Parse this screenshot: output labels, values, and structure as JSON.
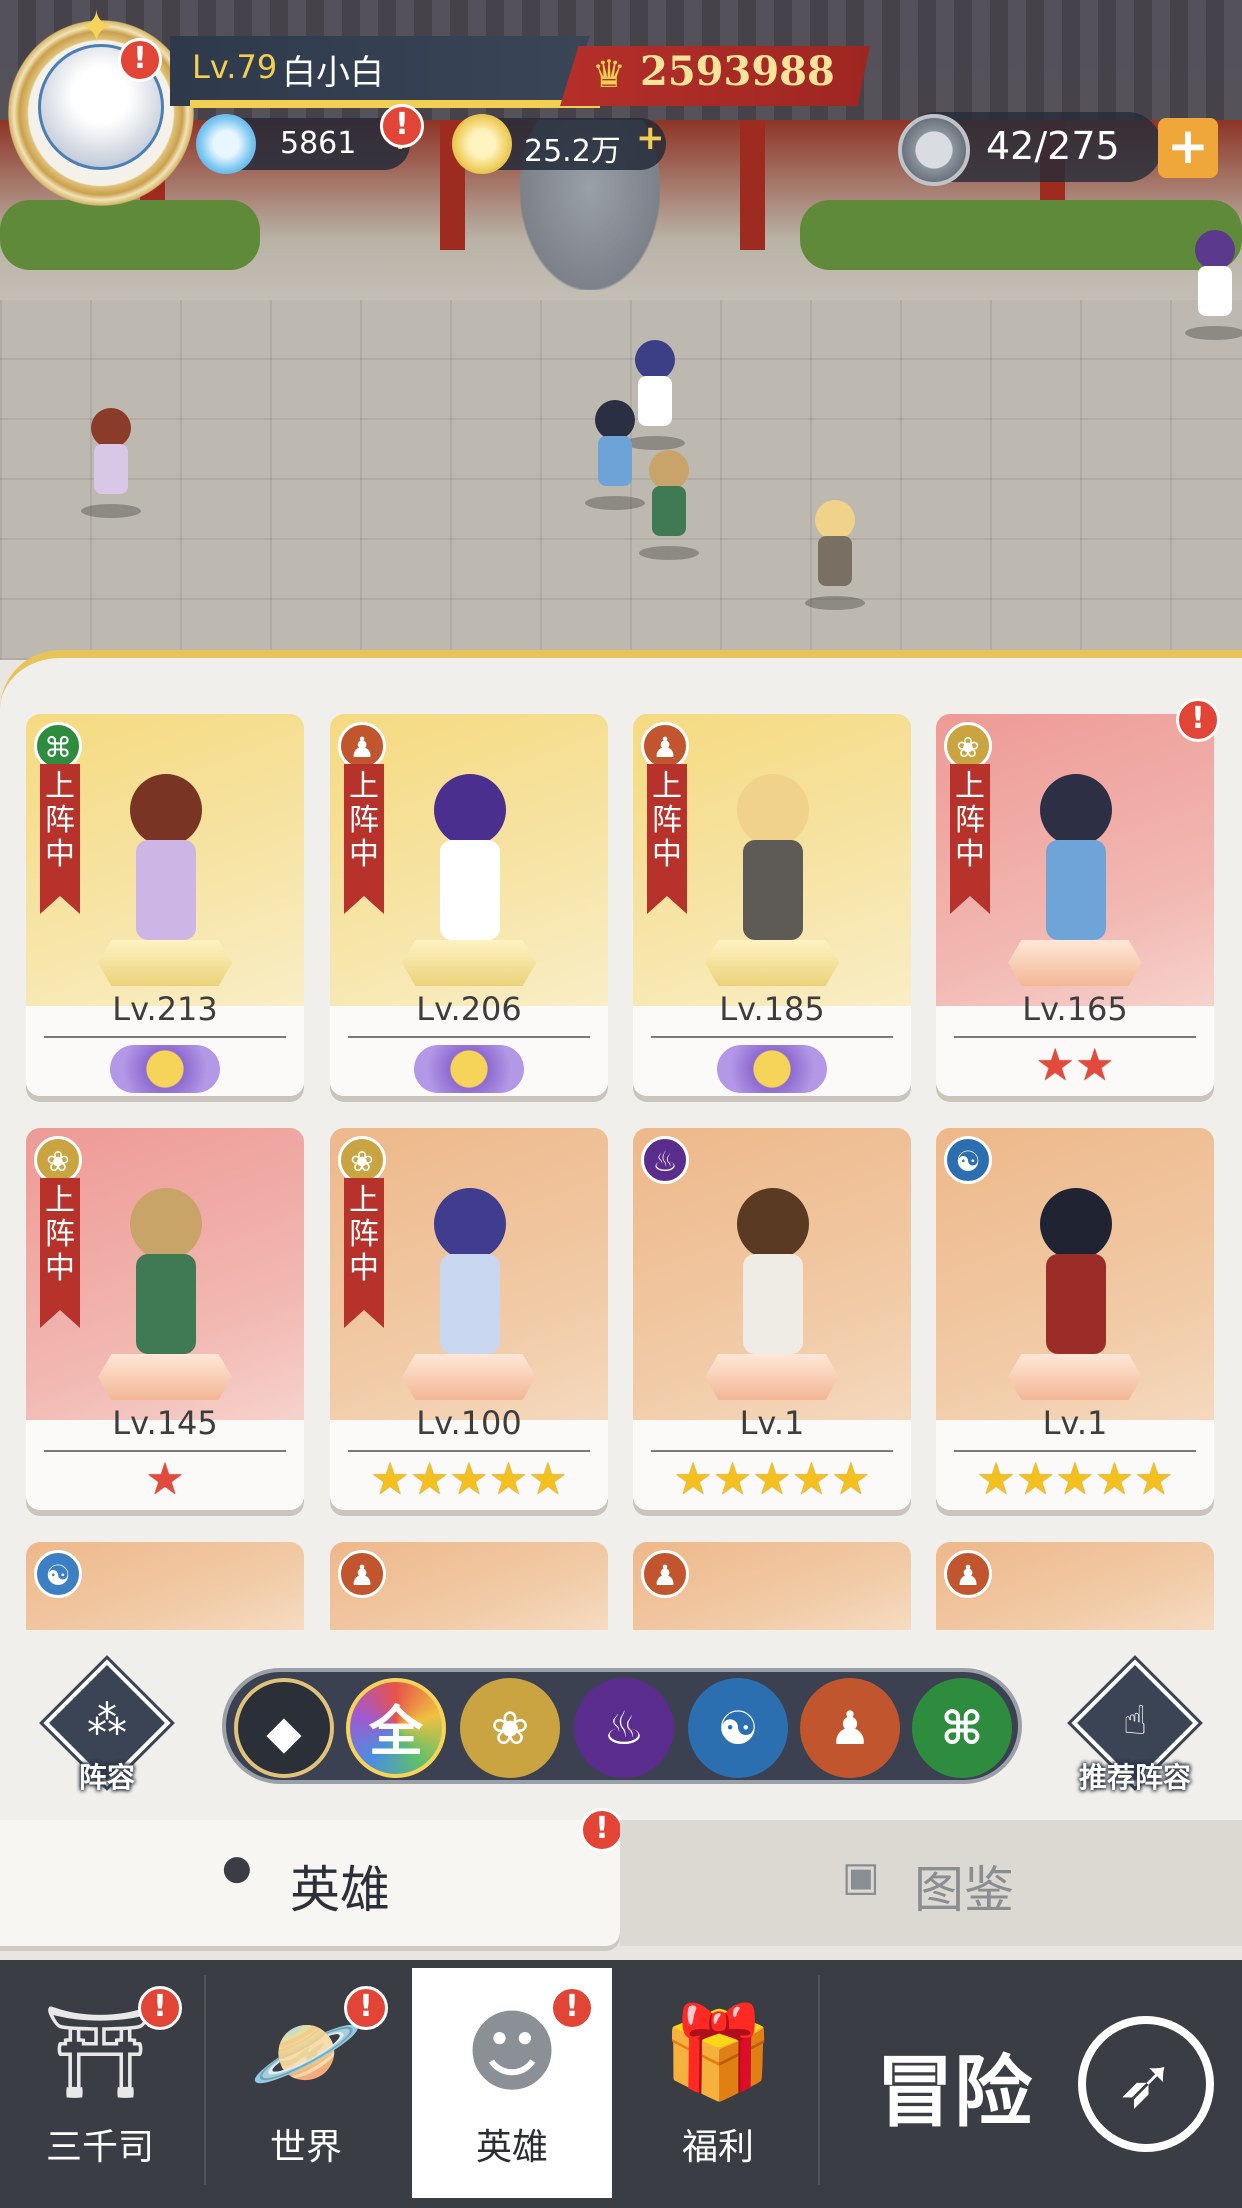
{
  "player": {
    "level": "Lv.79",
    "name": "白小白",
    "power": "2593988",
    "diamonds": "5861",
    "gold": "25.2万",
    "energy": "42/275"
  },
  "badge_text": "!",
  "heroes": [
    {
      "deployed": true,
      "ribbon": "上阵中",
      "element": "dna-icon",
      "level": "Lv.213",
      "rank": "crest",
      "stars": "✦",
      "theme": "gold"
    },
    {
      "deployed": true,
      "ribbon": "上阵中",
      "element": "meditation-icon",
      "level": "Lv.206",
      "rank": "crest",
      "stars": "✦",
      "theme": "gold"
    },
    {
      "deployed": true,
      "ribbon": "上阵中",
      "element": "meditation-icon",
      "level": "Lv.185",
      "rank": "crest",
      "stars": "✦",
      "theme": "gold"
    },
    {
      "deployed": true,
      "ribbon": "上阵中",
      "element": "lotus-icon",
      "level": "Lv.165",
      "rank": "red",
      "stars": "★★",
      "theme": "red"
    },
    {
      "deployed": true,
      "ribbon": "上阵中",
      "element": "lotus-icon",
      "level": "Lv.145",
      "rank": "red",
      "stars": "★",
      "theme": "red"
    },
    {
      "deployed": true,
      "ribbon": "上阵中",
      "element": "lotus-icon",
      "level": "Lv.100",
      "rank": "gold",
      "stars": "★★★★★",
      "theme": "tan"
    },
    {
      "deployed": false,
      "ribbon": "",
      "element": "flame-icon",
      "level": "Lv.1",
      "rank": "gold",
      "stars": "★★★★★",
      "theme": "tan"
    },
    {
      "deployed": false,
      "ribbon": "",
      "element": "yin-yang-icon",
      "level": "Lv.1",
      "rank": "gold",
      "stars": "★★★★★",
      "theme": "tan"
    }
  ],
  "filters": {
    "lineup_label": "阵容",
    "all_label": "全",
    "recommend_label": "推荐阵容"
  },
  "tabs": {
    "heroes": "英雄",
    "codex": "图鉴"
  },
  "nav": {
    "sanqiansi": "三千司",
    "world": "世界",
    "heroes": "英雄",
    "welfare": "福利",
    "adventure": "冒险"
  }
}
